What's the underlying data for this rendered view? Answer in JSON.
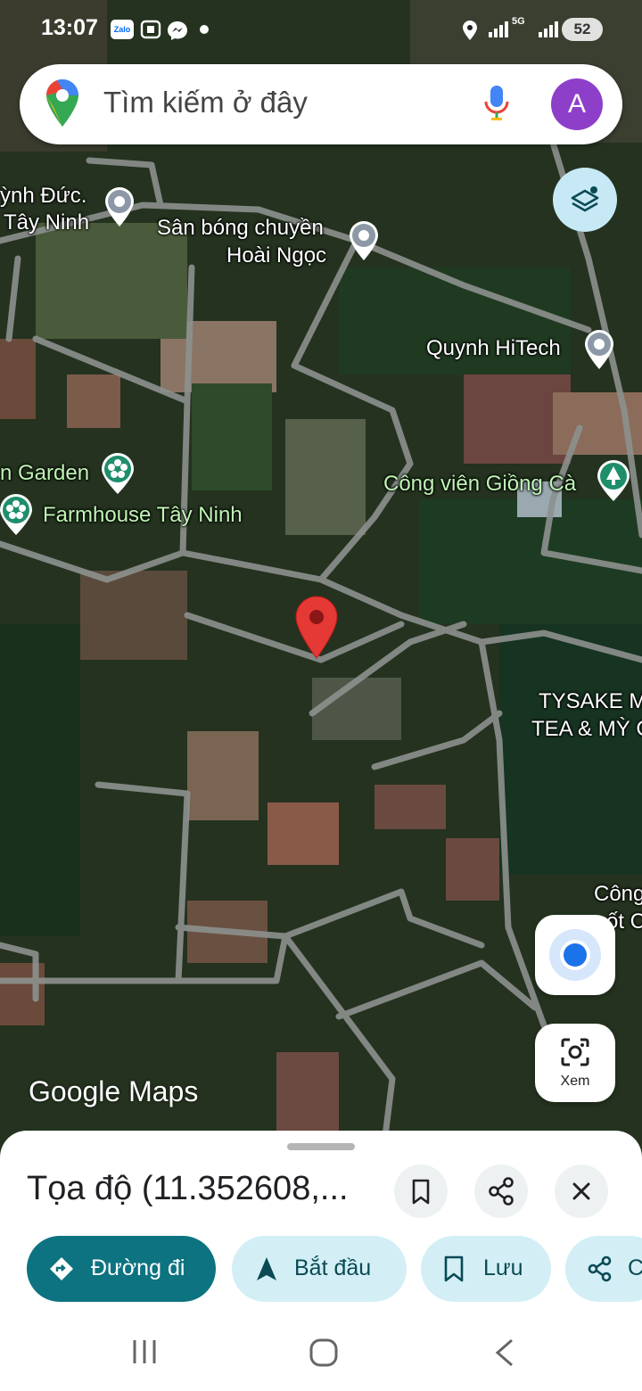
{
  "status_bar": {
    "time": "13:07",
    "notification_icons": [
      "zalo-icon",
      "screenshot-icon",
      "messenger-icon",
      "dot-icon"
    ],
    "zalo_text": "Zalo",
    "network": "5G",
    "battery": "52"
  },
  "search": {
    "placeholder": "Tìm kiếm ở đây",
    "avatar_letter": "A"
  },
  "map": {
    "labels": {
      "poi1": "ỳnh Đức.",
      "poi1_line2": "Tây Ninh",
      "poi2": "Sân bóng chuyền",
      "poi2_line2": "Hoài Ngọc",
      "poi3": "Quynh HiTech",
      "poi4": "n Garden",
      "poi5": "Farmhouse Tây Ninh",
      "poi6": "Công viên Giồng Cà",
      "poi7": "TYSAKE M",
      "poi7_line2": "TEA & MỲ C",
      "poi8": "Công",
      "poi8_line2": "ốt Ca"
    },
    "logo": "Google Maps",
    "lens_label": "Xem"
  },
  "place": {
    "title": "Tọa độ (11.352608,..."
  },
  "actions": {
    "directions": "Đường đi",
    "start": "Bắt đầu",
    "save": "Lưu",
    "share": "C"
  },
  "colors": {
    "accent": "#0d7380",
    "chip_bg": "#d3eff5",
    "pin": "#e53935",
    "location_dot": "#1a73e8",
    "avatar": "#8e3fc9"
  }
}
